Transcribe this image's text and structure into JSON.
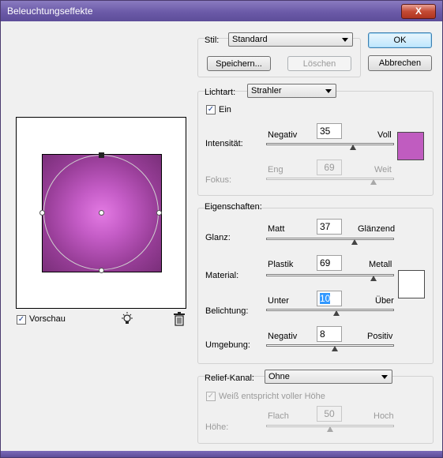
{
  "window": {
    "title": "Beleuchtungseffekte",
    "close_label": "X"
  },
  "style": {
    "label": "Stil:",
    "selected": "Standard",
    "save_button": "Speichern...",
    "delete_button": "Löschen"
  },
  "actions": {
    "ok": "OK",
    "cancel": "Abbrechen"
  },
  "light": {
    "type_label": "Lichtart:",
    "type_selected": "Strahler",
    "on_label": "Ein",
    "on_checked": true,
    "intensity": {
      "label": "Intensität:",
      "min_label": "Negativ",
      "max_label": "Voll",
      "value": "35",
      "fraction": 0.68,
      "color": "#c05cc0"
    },
    "focus": {
      "label": "Fokus:",
      "min_label": "Eng",
      "max_label": "Weit",
      "value": "69",
      "fraction": 0.84
    }
  },
  "properties": {
    "legend": "Eigenschaften:",
    "gloss": {
      "label": "Glanz:",
      "min_label": "Matt",
      "max_label": "Glänzend",
      "value": "37",
      "fraction": 0.69
    },
    "material": {
      "label": "Material:",
      "min_label": "Plastik",
      "max_label": "Metall",
      "value": "69",
      "fraction": 0.84,
      "color": "#ffffff"
    },
    "exposure": {
      "label": "Belichtung:",
      "min_label": "Unter",
      "max_label": "Über",
      "value": "10",
      "fraction": 0.55
    },
    "ambience": {
      "label": "Umgebung:",
      "min_label": "Negativ",
      "max_label": "Positiv",
      "value": "8",
      "fraction": 0.54
    }
  },
  "relief": {
    "channel_label": "Relief-Kanal:",
    "channel_selected": "Ohne",
    "white_high_label": "Weiß entspricht voller Höhe",
    "white_high_checked": true,
    "height": {
      "label": "Höhe:",
      "min_label": "Flach",
      "max_label": "Hoch",
      "value": "50",
      "fraction": 0.5
    }
  },
  "preview": {
    "label": "Vorschau",
    "checked": true,
    "light_icon": "lightbulb-icon",
    "trash_icon": "trash-icon"
  }
}
